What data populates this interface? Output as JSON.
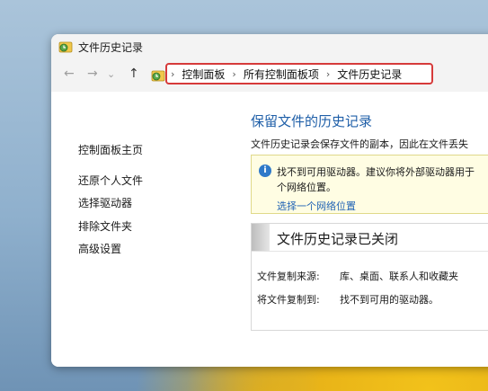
{
  "window": {
    "title": "文件历史记录"
  },
  "nav": {
    "back": "←",
    "forward": "→",
    "up": "↑",
    "chevron": "⌄"
  },
  "address": {
    "crumbs": [
      "控制面板",
      "所有控制面板项",
      "文件历史记录"
    ],
    "separator": "›"
  },
  "sidebar": {
    "items": [
      {
        "label": "控制面板主页"
      },
      {
        "label": "还原个人文件"
      },
      {
        "label": "选择驱动器"
      },
      {
        "label": "排除文件夹"
      },
      {
        "label": "高级设置"
      }
    ]
  },
  "main": {
    "title": "保留文件的历史记录",
    "description": "文件历史记录会保存文件的副本，因此在文件丢失"
  },
  "info": {
    "icon": "i",
    "line1": "找不到可用驱动器。建议你将外部驱动器用于",
    "line2": "个网络位置。",
    "link": "选择一个网络位置"
  },
  "status": {
    "title": "文件历史记录已关闭",
    "rows": [
      {
        "label": "文件复制来源:",
        "value": "库、桌面、联系人和收藏夹"
      },
      {
        "label": "将文件复制到:",
        "value": "找不到可用的驱动器。"
      }
    ]
  }
}
